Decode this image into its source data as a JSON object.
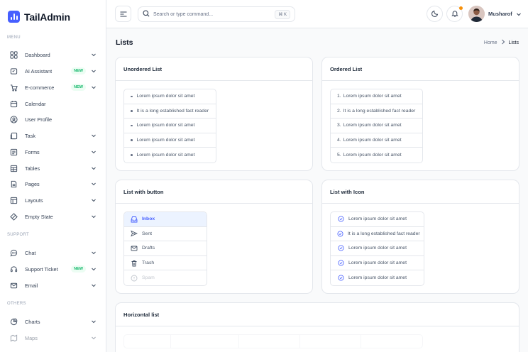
{
  "brand": {
    "name": "TailAdmin",
    "color": "#465fff"
  },
  "sidebar": {
    "menu_label": "MENU",
    "support_label": "SUPPORT",
    "others_label": "OTHERS",
    "items": [
      {
        "label": "Dashboard",
        "icon": "grid-icon",
        "chevron": true
      },
      {
        "label": "AI Assistant",
        "icon": "sparkle-icon",
        "badge": "NEW",
        "chevron": true
      },
      {
        "label": "E-commerce",
        "icon": "cart-icon",
        "badge": "NEW",
        "chevron": true
      },
      {
        "label": "Calendar",
        "icon": "calendar-icon"
      },
      {
        "label": "User Profile",
        "icon": "user-circle-icon"
      },
      {
        "label": "Task",
        "icon": "task-icon",
        "chevron": true
      },
      {
        "label": "Forms",
        "icon": "forms-icon",
        "chevron": true
      },
      {
        "label": "Tables",
        "icon": "table-icon",
        "chevron": true
      },
      {
        "label": "Pages",
        "icon": "pages-icon",
        "chevron": true
      },
      {
        "label": "Layouts",
        "icon": "layout-icon",
        "chevron": true
      },
      {
        "label": "Empty State",
        "icon": "empty-state-icon",
        "chevron": true
      }
    ],
    "support_items": [
      {
        "label": "Chat",
        "icon": "chat-icon",
        "chevron": true
      },
      {
        "label": "Support Ticket",
        "icon": "headset-icon",
        "badge": "NEW",
        "chevron": true
      },
      {
        "label": "Email",
        "icon": "mail-icon",
        "chevron": true
      }
    ],
    "other_items": [
      {
        "label": "Charts",
        "icon": "pie-chart-icon",
        "chevron": true
      },
      {
        "label": "Maps",
        "icon": "map-icon",
        "chevron": true
      }
    ]
  },
  "header": {
    "search_placeholder": "Search or type command...",
    "search_shortcut": "⌘ K",
    "user_name": "Musharof"
  },
  "page": {
    "title": "Lists",
    "breadcrumb_home": "Home",
    "breadcrumb_current": "Lists"
  },
  "cards": {
    "unordered": {
      "title": "Unordered List",
      "items": [
        "Lorem ipsum dolor sit amet",
        "It is a long established fact reader",
        "Lorem ipsum dolor sit amet",
        "Lorem ipsum dolor sit amet",
        "Lorem ipsum dolor sit amet"
      ]
    },
    "ordered": {
      "title": "Ordered List",
      "numbers": [
        "1.",
        "2.",
        "3.",
        "4.",
        "5."
      ],
      "items": [
        "Lorem ipsum dolor sit amet",
        "It is a long established fact reader",
        "Lorem ipsum dolor sit amet",
        "Lorem ipsum dolor sit amet",
        "Lorem ipsum dolor sit amet"
      ]
    },
    "button_list": {
      "title": "List with button",
      "items": [
        {
          "label": "Inbox",
          "icon": "inbox-icon"
        },
        {
          "label": "Sent",
          "icon": "send-icon"
        },
        {
          "label": "Drafts",
          "icon": "mail-icon"
        },
        {
          "label": "Trash",
          "icon": "trash-icon"
        },
        {
          "label": "Spam",
          "icon": "alert-icon"
        }
      ]
    },
    "icon_list": {
      "title": "List with Icon",
      "items": [
        "Lorem ipsum dolor sit amet",
        "It is a long established fact reader",
        "Lorem ipsum dolor sit amet",
        "Lorem ipsum dolor sit amet",
        "Lorem ipsum dolor sit amet"
      ]
    },
    "horizontal": {
      "title": "Horizontal list"
    }
  }
}
